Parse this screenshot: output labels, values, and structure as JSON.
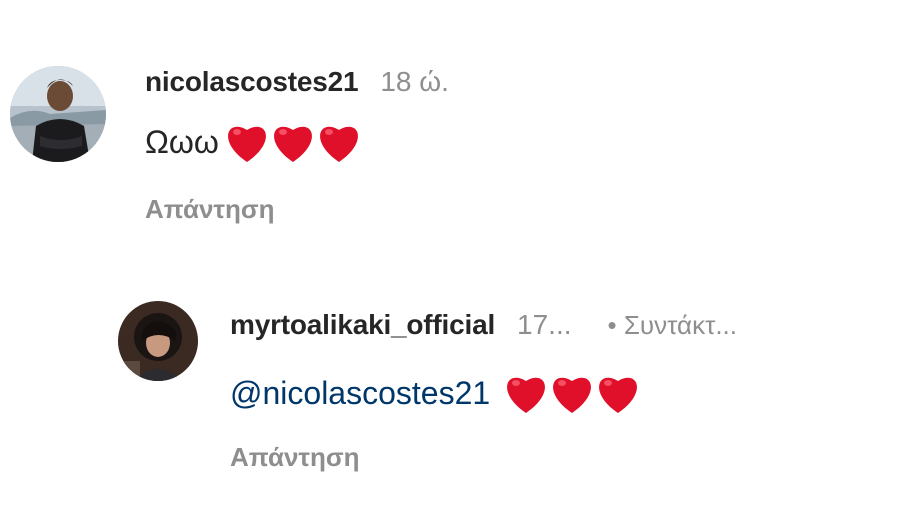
{
  "comments": [
    {
      "username": "nicolascostes21",
      "time": "18 ώ.",
      "text": "Ωωω",
      "hearts_icon": "red-heart-emoji",
      "reply_label": "Απάντηση"
    },
    {
      "username": "myrtoalikaki_official",
      "time": "17...",
      "edited_label": "• Συντάκτ...",
      "mention": "@nicolascostes21",
      "hearts_icon": "red-heart-emoji",
      "reply_label": "Απάντηση"
    }
  ],
  "colors": {
    "mention": "#00376b",
    "heart": "#e0102a",
    "secondary_text": "#8e8e8e"
  }
}
